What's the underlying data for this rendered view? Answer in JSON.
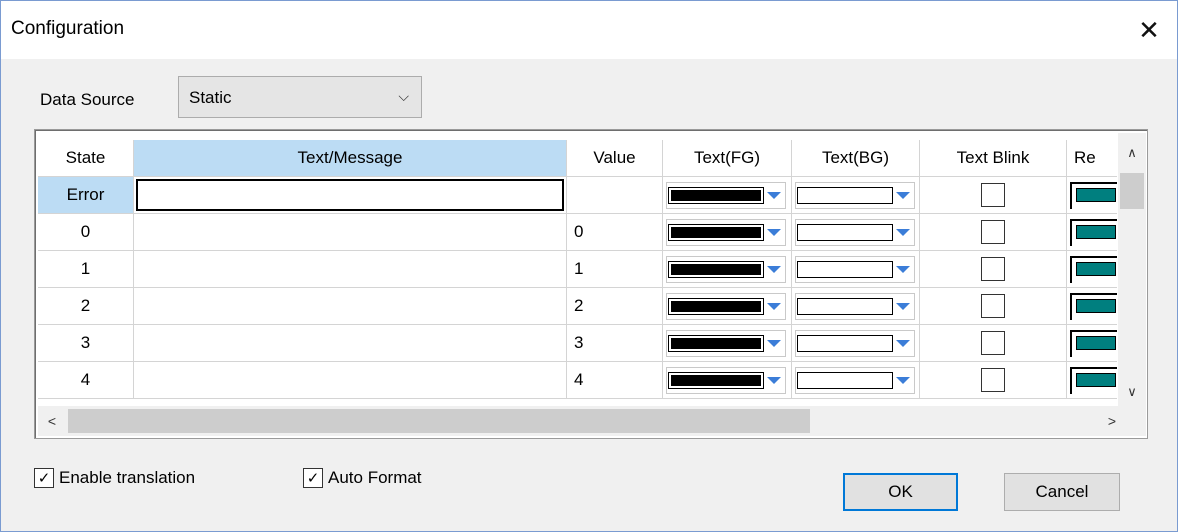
{
  "window": {
    "title": "Configuration",
    "close_glyph": "✕"
  },
  "data_source": {
    "label": "Data Source",
    "selected": "Static",
    "chevron": "⌵"
  },
  "grid": {
    "columns": [
      "State",
      "Text/Message",
      "Value",
      "Text(FG)",
      "Text(BG)",
      "Text Blink",
      "Re"
    ],
    "rows": [
      {
        "state": "Error",
        "message": "",
        "value": "",
        "fg_color": "#000000",
        "bg_color": "#ffffff",
        "blink": false,
        "re_color": "#007f7f"
      },
      {
        "state": "0",
        "message": "",
        "value": "0",
        "fg_color": "#000000",
        "bg_color": "#ffffff",
        "blink": false,
        "re_color": "#007f7f"
      },
      {
        "state": "1",
        "message": "",
        "value": "1",
        "fg_color": "#000000",
        "bg_color": "#ffffff",
        "blink": false,
        "re_color": "#007f7f"
      },
      {
        "state": "2",
        "message": "",
        "value": "2",
        "fg_color": "#000000",
        "bg_color": "#ffffff",
        "blink": false,
        "re_color": "#007f7f"
      },
      {
        "state": "3",
        "message": "",
        "value": "3",
        "fg_color": "#000000",
        "bg_color": "#ffffff",
        "blink": false,
        "re_color": "#007f7f"
      },
      {
        "state": "4",
        "message": "",
        "value": "4",
        "fg_color": "#000000",
        "bg_color": "#ffffff",
        "blink": false,
        "re_color": "#007f7f"
      }
    ],
    "scroll": {
      "up": "∧",
      "down": "∨",
      "left": "<",
      "right": ">"
    }
  },
  "options": {
    "enable_translation": {
      "label": "Enable translation",
      "checked": true,
      "mark": "✓"
    },
    "auto_format": {
      "label": "Auto Format",
      "checked": true,
      "mark": "✓"
    }
  },
  "buttons": {
    "ok": "OK",
    "cancel": "Cancel"
  },
  "colors": {
    "selection": "#bcdcf4",
    "accent": "#0078d7",
    "teal": "#007f7f"
  }
}
